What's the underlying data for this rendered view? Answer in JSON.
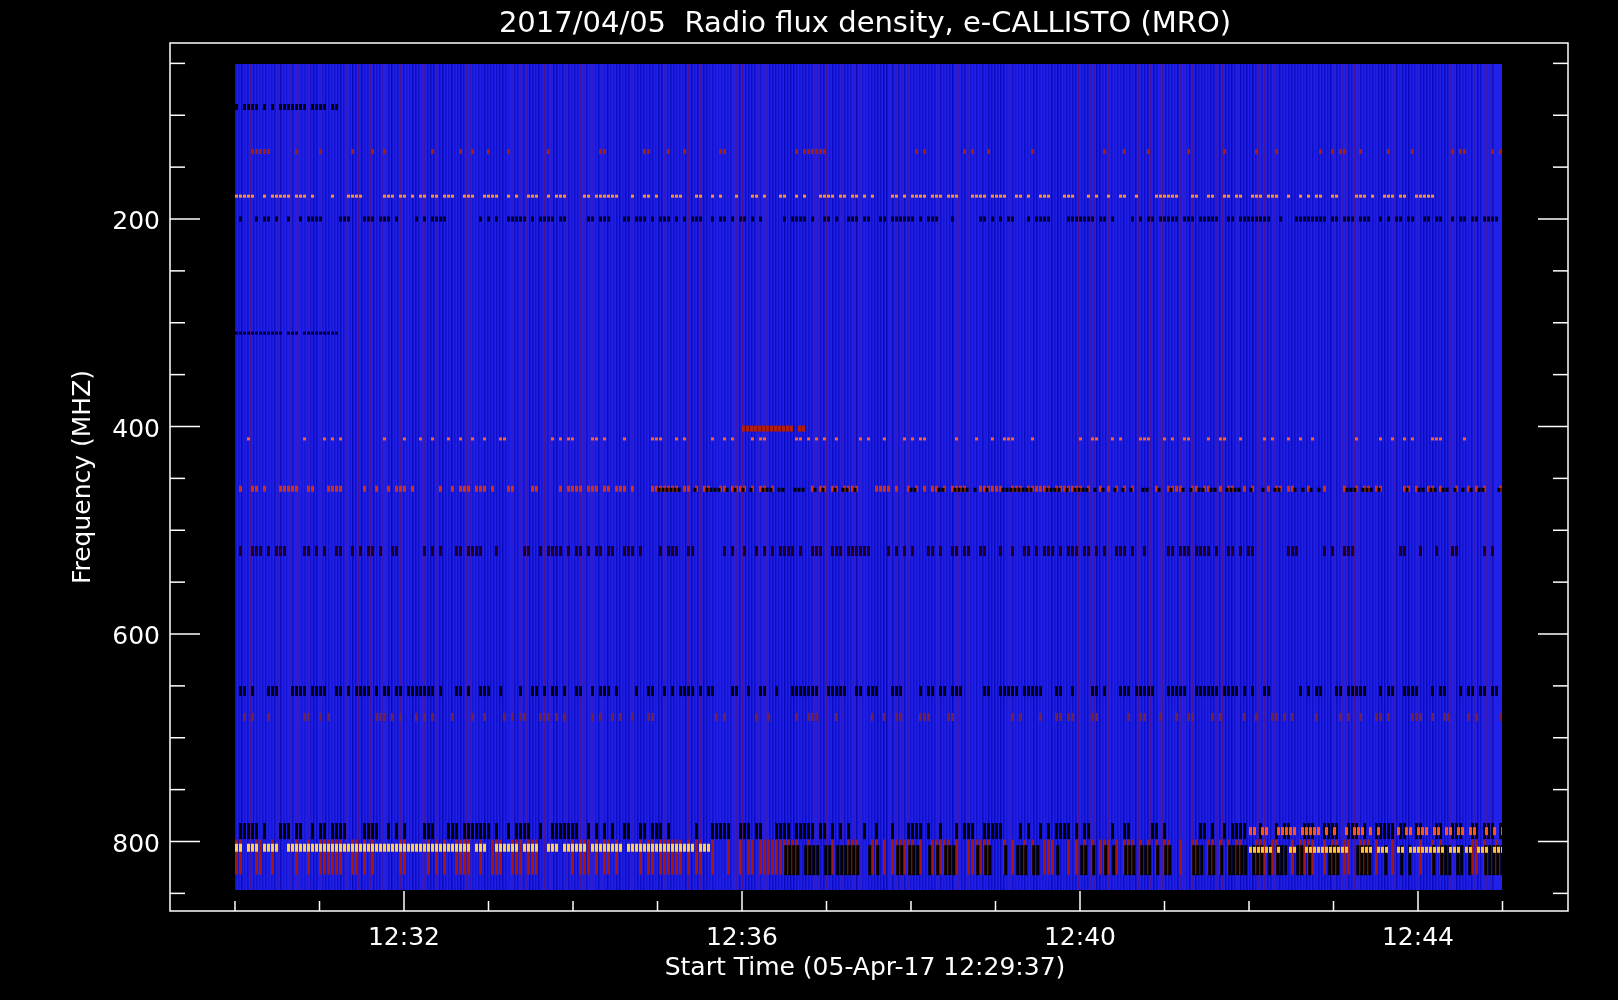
{
  "title": "2017/04/05  Radio flux density, e-CALLISTO (MRO)",
  "y_axis": {
    "label": "Frequency (MHZ)",
    "ticks": [
      "200",
      "400",
      "600",
      "800"
    ]
  },
  "x_axis": {
    "label": "Start Time (05-Apr-17 12:29:37)",
    "ticks": [
      "12:32",
      "12:36",
      "12:40",
      "12:44"
    ]
  }
}
